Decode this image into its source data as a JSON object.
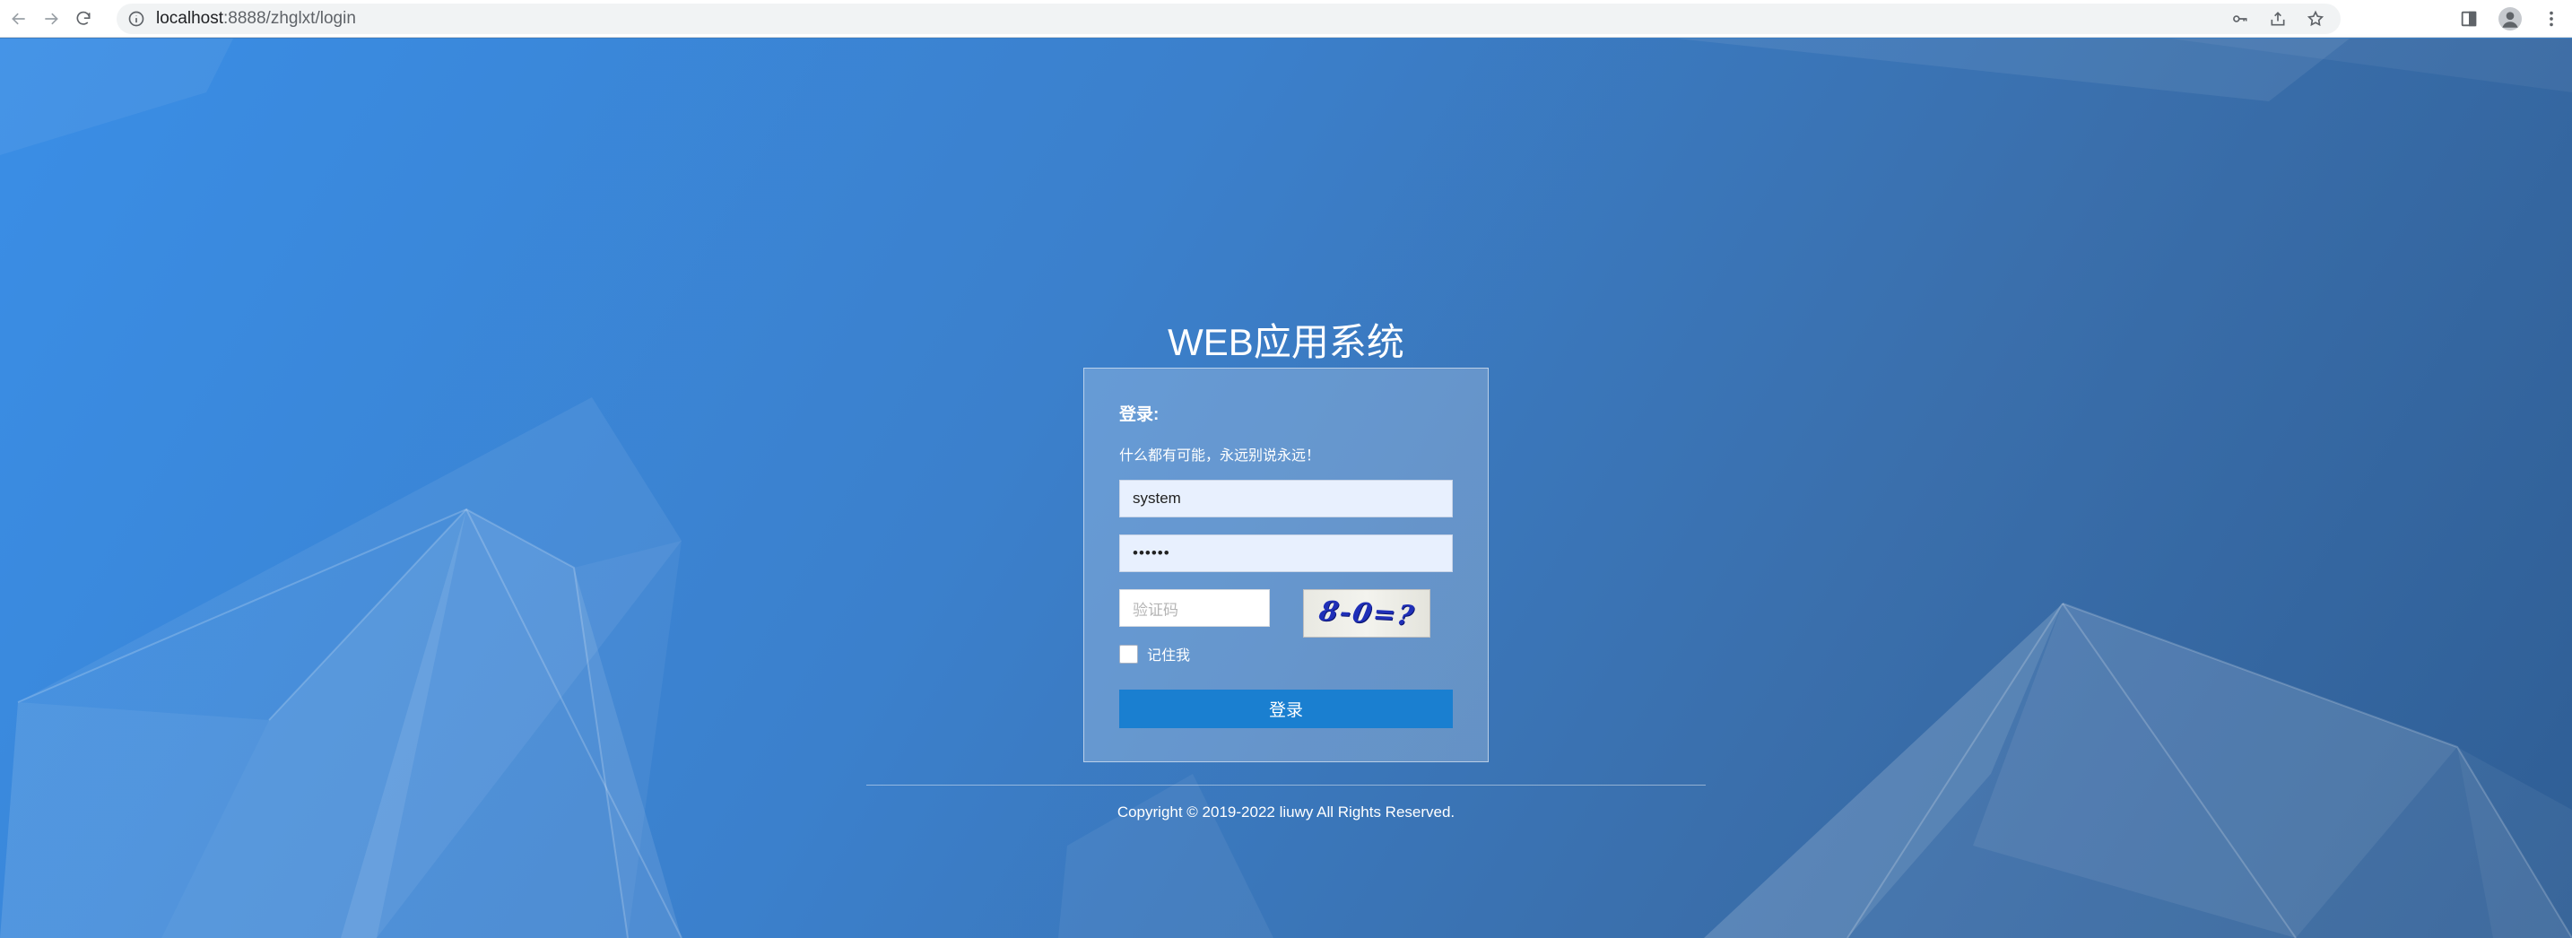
{
  "browser": {
    "url_host": "localhost",
    "url_path": ":8888/zhglxt/login"
  },
  "login": {
    "system_title": "WEB应用系统",
    "heading": "登录:",
    "motto": "什么都有可能，永远别说永远！",
    "username_value": "system",
    "password_value": "••••••",
    "captcha_placeholder": "验证码",
    "captcha_text": "8-0=?",
    "remember_label": "记住我",
    "submit_label": "登录"
  },
  "footer": {
    "copyright": "Copyright © 2019-2022 liuwy All Rights Reserved."
  },
  "colors": {
    "primary_button": "#1a7fd0",
    "background_blue": "#3b80cc",
    "field_fill": "#e8f0fe"
  }
}
